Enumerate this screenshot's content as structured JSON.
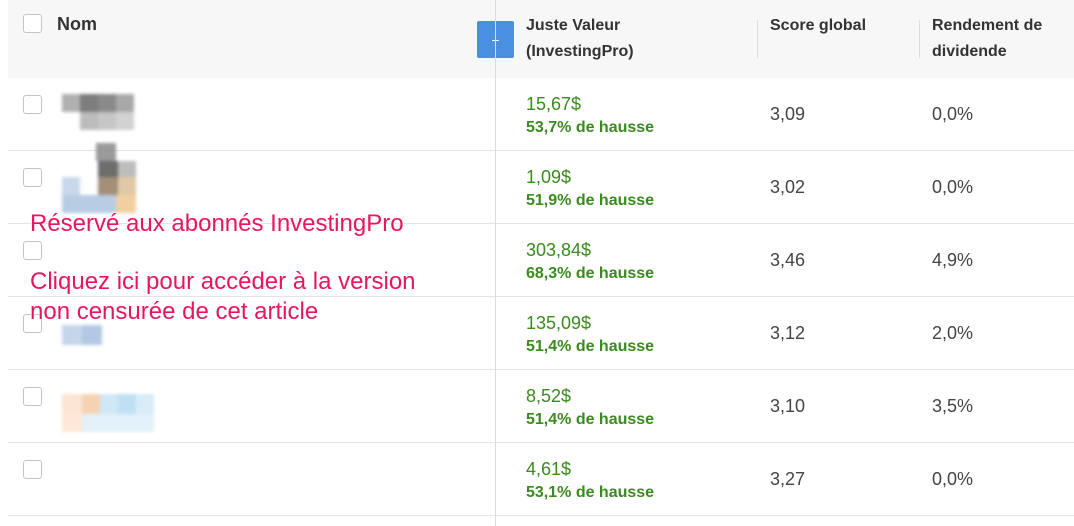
{
  "header": {
    "name_label": "Nom",
    "add_column_label": "+",
    "fair_value_label_line1": "Juste Valeur",
    "fair_value_label_line2": "(InvestingPro)",
    "score_label": "Score global",
    "dividend_label_line1": "Rendement de",
    "dividend_label_line2": "dividende"
  },
  "rows": [
    {
      "fair_value": "15,67$",
      "upside": "53,7% de hausse",
      "score": "3,09",
      "dividend_yield": "0,0%"
    },
    {
      "fair_value": "1,09$",
      "upside": "51,9% de hausse",
      "score": "3,02",
      "dividend_yield": "0,0%"
    },
    {
      "fair_value": "303,84$",
      "upside": "68,3% de hausse",
      "score": "3,46",
      "dividend_yield": "4,9%"
    },
    {
      "fair_value": "135,09$",
      "upside": "51,4% de hausse",
      "score": "3,12",
      "dividend_yield": "2,0%"
    },
    {
      "fair_value": "8,52$",
      "upside": "51,4% de hausse",
      "score": "3,10",
      "dividend_yield": "3,5%"
    },
    {
      "fair_value": "4,61$",
      "upside": "53,1% de hausse",
      "score": "3,27",
      "dividend_yield": "0,0%"
    }
  ],
  "promo": {
    "subscribers_only": "Réservé aux abonnés InvestingPro",
    "unlock_line1": "Cliquez ici pour accéder à la version",
    "unlock_line2": "non censurée de cet article"
  },
  "colors": {
    "positive_green": "#3a8a1f",
    "promo_pink": "#e8175d",
    "add_button_blue": "#4a8fe0"
  }
}
